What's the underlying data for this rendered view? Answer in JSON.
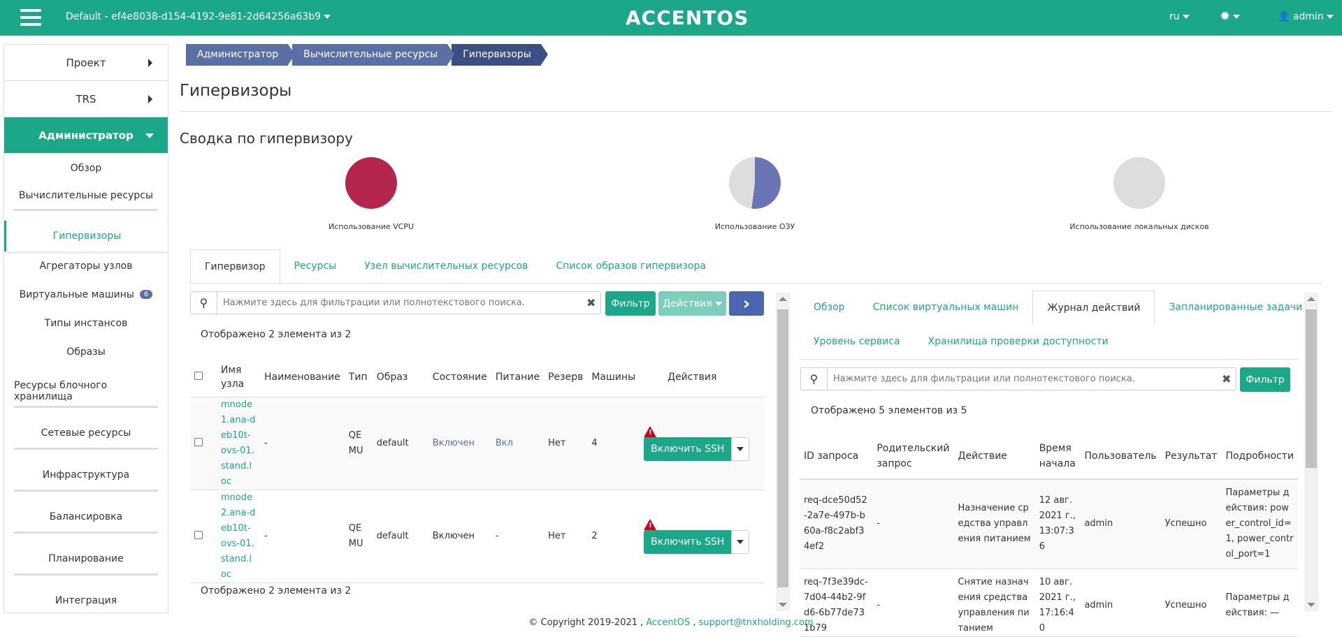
{
  "topbar": {
    "project": "Default - ef4e8038-d154-4192-9e81-2d64256a63b9",
    "logo": "ACCENTOS",
    "lang": "ru",
    "user": "admin",
    "bg_color": "#1aa888"
  },
  "sidebar": {
    "project": "Проект",
    "trs": "TRS",
    "admin": "Администратор",
    "items": [
      "Обзор",
      "Вычислительные ресурсы",
      "Гипервизоры",
      "Агрегаторы узлов",
      "Виртуальные машины",
      "Типы инстансов",
      "Образы",
      "Ресурсы блочного хранилища",
      "Сетевые ресурсы",
      "Инфраструктура",
      "Балансировка",
      "Планирование",
      "Интеграция"
    ],
    "vm_badge": "6"
  },
  "breadcrumb": [
    "Администратор",
    "Вычислительные ресурсы",
    "Гипервизоры"
  ],
  "page_title": "Гипервизоры",
  "summary": {
    "title": "Сводка по гипервизору",
    "vcpu_label": "Использование VCPU",
    "ram_label": "Использование ОЗУ",
    "disk_label": "Использование локальных дисков",
    "vcpu_color": "#b5264f",
    "ram_color": "#6b74b4",
    "disk_color": "#dddddd"
  },
  "tabs": [
    "Гипервизор",
    "Ресурсы",
    "Узел вычислительных ресурсов",
    "Список образов гипервизора"
  ],
  "left": {
    "search_placeholder": "Нажмите здесь для фильтрации или полнотекстового поиска.",
    "filter_btn": "Фильтр",
    "actions_btn": "Действия",
    "count_top": "Отображено 2 элемента из 2",
    "count_bottom": "Отображено 2 элемента из 2",
    "headers": [
      "Имя узла",
      "Наименование",
      "Тип",
      "Образ",
      "Состояние",
      "Питание",
      "Резерв",
      "Машины",
      "Действия"
    ],
    "rows": [
      {
        "name": "mnode1.ana-deb10t-ovs-01.stand.loc",
        "title": "-",
        "type": "QEMU",
        "image": "default",
        "state": "Включен",
        "power": "Вкл",
        "reserve": "Нет",
        "machines": "4",
        "action": "Включить SSH"
      },
      {
        "name": "mnode2.ana-deb10t-ovs-01.stand.loc",
        "title": "-",
        "type": "QEMU",
        "image": "default",
        "state": "Включен",
        "power": "-",
        "reserve": "Нет",
        "machines": "2",
        "action": "Включить SSH"
      }
    ]
  },
  "right": {
    "tabs_row1": [
      "Обзор",
      "Список виртуальных машин",
      "Журнал действий",
      "Запланированные задачи"
    ],
    "tabs_row2": [
      "Уровень сервиса",
      "Хранилища проверки доступности"
    ],
    "search_placeholder": "Нажмите здесь для фильтрации или полнотекстового поиска.",
    "filter_btn": "Фильтр",
    "count": "Отображено 5 элементов из 5",
    "headers": [
      "ID запроса",
      "Родительский запрос",
      "Действие",
      "Время начала",
      "Пользователь",
      "Результат",
      "Подробности"
    ],
    "rows": [
      {
        "id": "req-dce50d52-2a7e-497b-b60a-f8c2abf34ef2",
        "parent": "-",
        "action": "Назначение средства управления питанием",
        "time": "12 авг. 2021 г., 13:07:36",
        "user": "admin",
        "result": "Успешно",
        "details": "Параметры действия: power_control_id=1, power_control_port=1"
      },
      {
        "id": "req-7f3e39dc-7d04-44b2-9fd6-6b77de731b79",
        "parent": "-",
        "action": "Снятие назначения средства управления питанием",
        "time": "10 авг. 2021 г., 17:16:40",
        "user": "admin",
        "result": "Успешно",
        "details": "Параметры действия: —"
      }
    ]
  },
  "footer": {
    "copyright": "© Copyright 2019-2021 ,",
    "link1": "AccentOS",
    "sep": ",",
    "link2": "support@tnxholding.com"
  }
}
